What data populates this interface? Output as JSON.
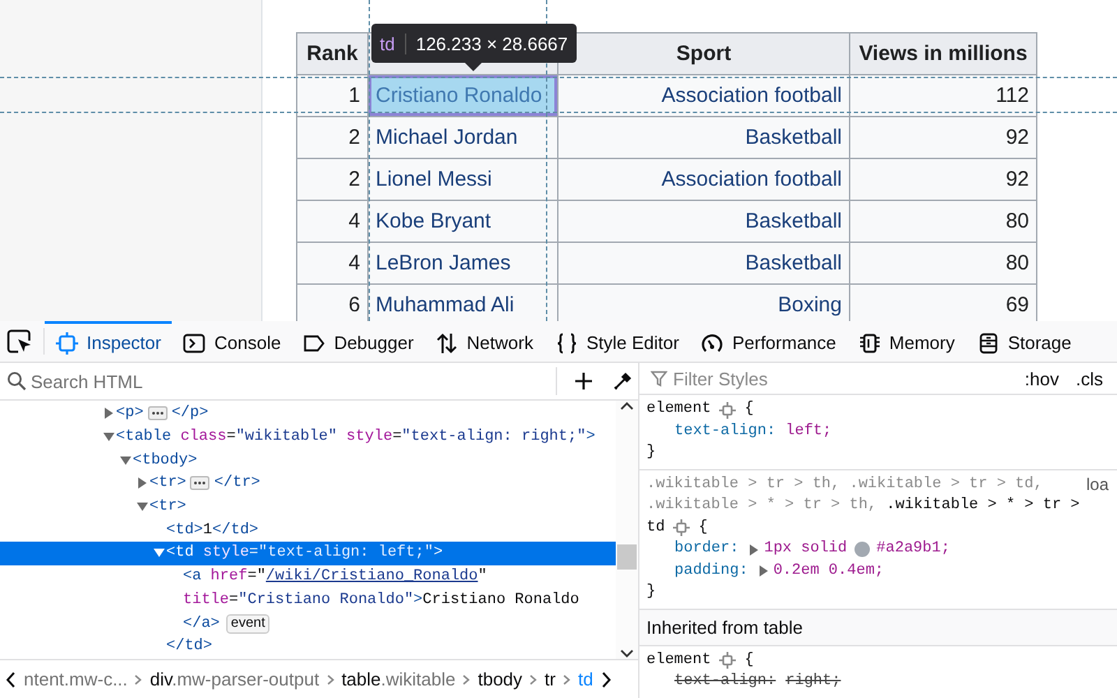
{
  "page": {
    "columns": [
      {
        "label": "Rank"
      },
      {},
      {
        "label": "Sport"
      },
      {
        "label": "Views in millions"
      }
    ],
    "rows": [
      {
        "rank": "1",
        "name": "Cristiano Ronaldo",
        "sport": "Association football",
        "views": "112",
        "highlighted": true
      },
      {
        "rank": "2",
        "name": "Michael Jordan",
        "sport": "Basketball",
        "views": "92",
        "highlighted": false
      },
      {
        "rank": "2",
        "name": "Lionel Messi",
        "sport": "Association football",
        "views": "92",
        "highlighted": false
      },
      {
        "rank": "4",
        "name": "Kobe Bryant",
        "sport": "Basketball",
        "views": "80",
        "highlighted": false
      },
      {
        "rank": "4",
        "name": "LeBron James",
        "sport": "Basketball",
        "views": "80",
        "highlighted": false
      },
      {
        "rank": "6",
        "name": "Muhammad Ali",
        "sport": "Boxing",
        "views": "69",
        "highlighted": false
      }
    ],
    "tooltip": {
      "tag": "td",
      "size": "126.233 × 28.6667"
    }
  },
  "toolbar": {
    "tabs": [
      {
        "label": "Inspector",
        "selected": true
      },
      {
        "label": "Console",
        "selected": false
      },
      {
        "label": "Debugger",
        "selected": false
      },
      {
        "label": "Network",
        "selected": false
      },
      {
        "label": "Style Editor",
        "selected": false
      },
      {
        "label": "Performance",
        "selected": false
      },
      {
        "label": "Memory",
        "selected": false
      },
      {
        "label": "Storage",
        "selected": false
      }
    ]
  },
  "inspector": {
    "search": {
      "placeholder": "Search HTML"
    },
    "tree": [
      {
        "kind": "container",
        "expanded": false,
        "selected": false,
        "open": [
          {
            "kind": "tag",
            "text": "<p>"
          }
        ],
        "close": [
          {
            "kind": "tag",
            "text": "</p>"
          }
        ]
      },
      {
        "kind": "container",
        "expanded": true,
        "selected": false,
        "open": [
          {
            "kind": "tag",
            "text": "<table"
          },
          {
            "kind": "attr",
            "text": " class"
          },
          {
            "kind": "text",
            "text": "="
          },
          {
            "kind": "val",
            "text": "\"wikitable\""
          },
          {
            "kind": "attr",
            "text": " style"
          },
          {
            "kind": "text",
            "text": "="
          },
          {
            "kind": "val",
            "text": "\"text-align: right;\""
          },
          {
            "kind": "tag",
            "text": ">"
          }
        ],
        "children": [
          {
            "kind": "container",
            "expanded": true,
            "selected": false,
            "open": [
              {
                "kind": "tag",
                "text": "<tbody>"
              }
            ],
            "children": [
              {
                "kind": "container",
                "expanded": false,
                "selected": false,
                "open": [
                  {
                    "kind": "tag",
                    "text": "<tr>"
                  }
                ],
                "close": [
                  {
                    "kind": "tag",
                    "text": "</tr>"
                  }
                ]
              },
              {
                "kind": "container",
                "expanded": true,
                "selected": false,
                "open": [
                  {
                    "kind": "tag",
                    "text": "<tr>"
                  }
                ],
                "children": [
                  {
                    "kind": "leaf",
                    "selected": false,
                    "lines": [
                      [
                        {
                          "kind": "tag",
                          "text": "<td>"
                        },
                        {
                          "kind": "text",
                          "text": "1"
                        },
                        {
                          "kind": "tag",
                          "text": "</td>"
                        }
                      ]
                    ]
                  },
                  {
                    "kind": "container",
                    "expanded": true,
                    "selected": true,
                    "open": [
                      {
                        "kind": "tag",
                        "text": "<td"
                      },
                      {
                        "kind": "attr",
                        "text": " style"
                      },
                      {
                        "kind": "text",
                        "text": "="
                      },
                      {
                        "kind": "val",
                        "text": "\"text-align: left;\""
                      },
                      {
                        "kind": "tag",
                        "text": ">"
                      }
                    ],
                    "children": [
                      {
                        "kind": "leaf",
                        "selected": false,
                        "badge": "event",
                        "lines": [
                          [
                            {
                              "kind": "tag",
                              "text": "<a"
                            },
                            {
                              "kind": "attr",
                              "text": " href"
                            },
                            {
                              "kind": "text",
                              "text": "=\""
                            },
                            {
                              "kind": "link",
                              "text": "/wiki/Cristiano_Ronaldo"
                            },
                            {
                              "kind": "text",
                              "text": "\""
                            }
                          ],
                          [
                            {
                              "kind": "attr",
                              "text": "title"
                            },
                            {
                              "kind": "text",
                              "text": "="
                            },
                            {
                              "kind": "val",
                              "text": "\"Cristiano Ronaldo\""
                            },
                            {
                              "kind": "tag",
                              "text": ">"
                            },
                            {
                              "kind": "text",
                              "text": "Cristiano Ronaldo"
                            }
                          ],
                          [
                            {
                              "kind": "tag",
                              "text": "</a>"
                            }
                          ]
                        ]
                      }
                    ],
                    "close": [
                      {
                        "kind": "tag",
                        "text": "</td>"
                      }
                    ]
                  }
                ]
              }
            ]
          }
        ]
      }
    ],
    "breadcrumbs": [
      {
        "cls": "ntent.mw-c...",
        "selected": false
      },
      {
        "tag": "div",
        "cls": ".mw-parser-output",
        "selected": false
      },
      {
        "tag": "table",
        "cls": ".wikitable",
        "selected": false
      },
      {
        "tag": "tbody",
        "selected": false
      },
      {
        "tag": "tr",
        "selected": false
      },
      {
        "tag": "td",
        "selected": true
      }
    ]
  },
  "rules": {
    "filter": {
      "placeholder": "Filter Styles"
    },
    "toggles": [
      ":hov",
      ".cls"
    ],
    "sections": [
      {
        "kind": "rule",
        "open": "{",
        "close": "}",
        "selector": [
          [
            {
              "text": "element",
              "matched": true
            }
          ]
        ],
        "decls": [
          {
            "name": "text-align:",
            "value": "left;",
            "expandable": false,
            "overridden": false
          }
        ]
      },
      {
        "kind": "rule",
        "source": "loa",
        "open": "{",
        "close": "}",
        "selector": [
          [
            {
              "text": ".wikitable > tr > th, .wikitable > tr > td,",
              "matched": false
            }
          ],
          [
            {
              "text": ".wikitable > * > tr > th,",
              "matched": false
            },
            {
              "text": " .wikitable > * > tr >",
              "matched": true
            }
          ],
          [
            {
              "text": "td",
              "matched": true
            }
          ]
        ],
        "decls": [
          {
            "name": "border:",
            "value": "1px solid",
            "color": "#a2a9b1",
            "color_text": "#a2a9b1;",
            "expandable": true,
            "overridden": false
          },
          {
            "name": "padding:",
            "value": "0.2em 0.4em;",
            "expandable": true,
            "overridden": false
          }
        ]
      },
      {
        "kind": "header",
        "text": "Inherited from table"
      },
      {
        "kind": "rule",
        "open": "{",
        "selector": [
          [
            {
              "text": "element",
              "matched": true
            }
          ]
        ],
        "decls": [
          {
            "name": "text-align:",
            "value": "right;",
            "expandable": false,
            "overridden": true
          }
        ]
      }
    ]
  }
}
